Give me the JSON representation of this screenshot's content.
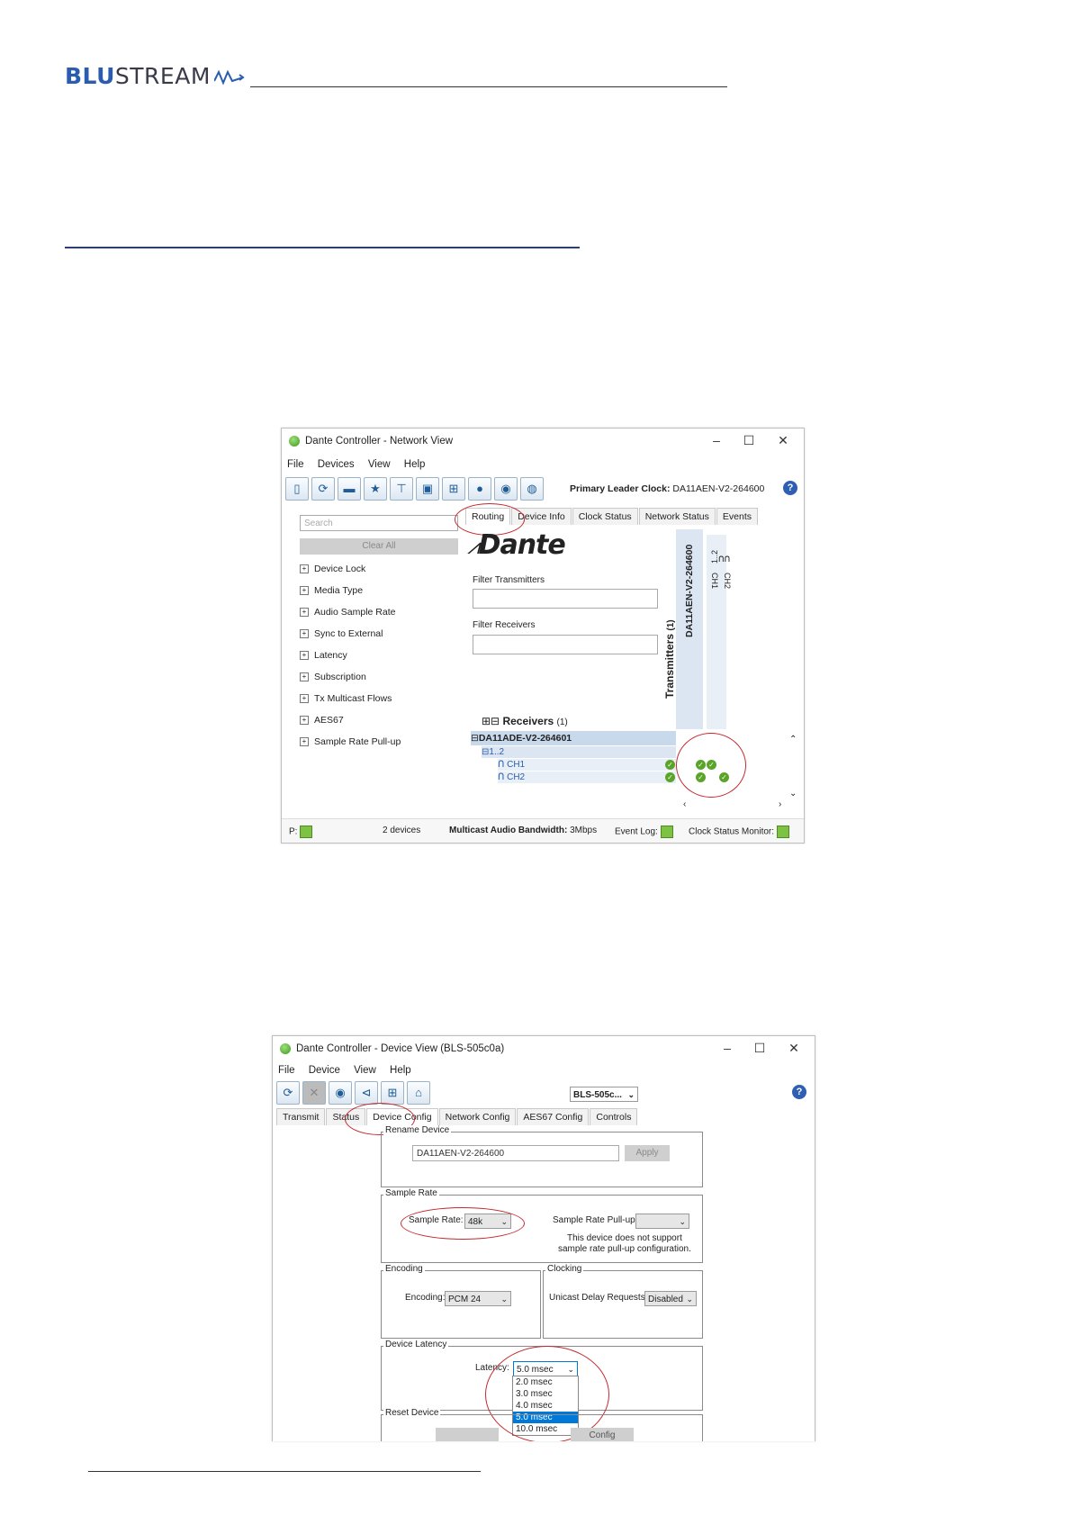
{
  "logo": {
    "part1": "BLU",
    "part2": "STREAM"
  },
  "win1": {
    "title": "Dante Controller - Network View",
    "menu": [
      "File",
      "Devices",
      "View",
      "Help"
    ],
    "primary_leader_label": "Primary Leader Clock:",
    "primary_leader_value": "DA11AEN-V2-264600",
    "tabs": [
      "Routing",
      "Device Info",
      "Clock Status",
      "Network Status",
      "Events"
    ],
    "search_placeholder": "Search",
    "clear_all": "Clear All",
    "filters": [
      "Device Lock",
      "Media Type",
      "Audio Sample Rate",
      "Sync to External",
      "Latency",
      "Subscription",
      "Tx Multicast Flows",
      "AES67",
      "Sample Rate Pull-up"
    ],
    "dante_logo": "Dante",
    "filter_tx_label": "Filter Transmitters",
    "filter_rx_label": "Filter Receivers",
    "transmitters_label": "Transmitters",
    "transmitters_count": "(1)",
    "tx_device": "DA11AEN-V2-264600",
    "tx_range": "1..2",
    "tx_ch1": "CH1",
    "tx_ch2": "CH2",
    "receivers_label": "Receivers",
    "receivers_count": "(1)",
    "rx_device": "DA11ADE-V2-264601",
    "rx_range": "1..2",
    "rx_ch1": "CH1",
    "rx_ch2": "CH2",
    "status_p": "P:",
    "status_devices": "2 devices",
    "status_bw_label": "Multicast Audio Bandwidth:",
    "status_bw_value": "3Mbps",
    "status_eventlog": "Event Log:",
    "status_clockmon": "Clock Status Monitor:"
  },
  "win2": {
    "title": "Dante Controller - Device View (BLS-505c0a)",
    "menu": [
      "File",
      "Device",
      "View",
      "Help"
    ],
    "device_select": "BLS-505c...",
    "tabs": [
      "Transmit",
      "Status",
      "Device Config",
      "Network Config",
      "AES67 Config",
      "Controls"
    ],
    "rename_group": "Rename Device",
    "rename_value": "DA11AEN-V2-264600",
    "apply": "Apply",
    "sample_rate_group": "Sample Rate",
    "sample_rate_label": "Sample Rate:",
    "sample_rate_value": "48k",
    "pullup_label": "Sample Rate Pull-up:",
    "pullup_note1": "This device does not support",
    "pullup_note2": "sample rate pull-up configuration.",
    "encoding_group": "Encoding",
    "encoding_label": "Encoding:",
    "encoding_value": "PCM 24",
    "clocking_group": "Clocking",
    "unicast_label": "Unicast Delay Requests:",
    "unicast_value": "Disabled",
    "latency_group": "Device Latency",
    "latency_label": "Latency:",
    "latency_value": "5.0 msec",
    "latency_options": [
      "2.0 msec",
      "3.0 msec",
      "4.0 msec",
      "5.0 msec",
      "10.0 msec"
    ],
    "reset_group": "Reset Device",
    "reset_partial": "Config"
  },
  "colors": {
    "brand_blue": "#2a5db0",
    "ring_red": "#c4282d",
    "status_green": "#7dc242",
    "select_blue": "#0078d7"
  }
}
